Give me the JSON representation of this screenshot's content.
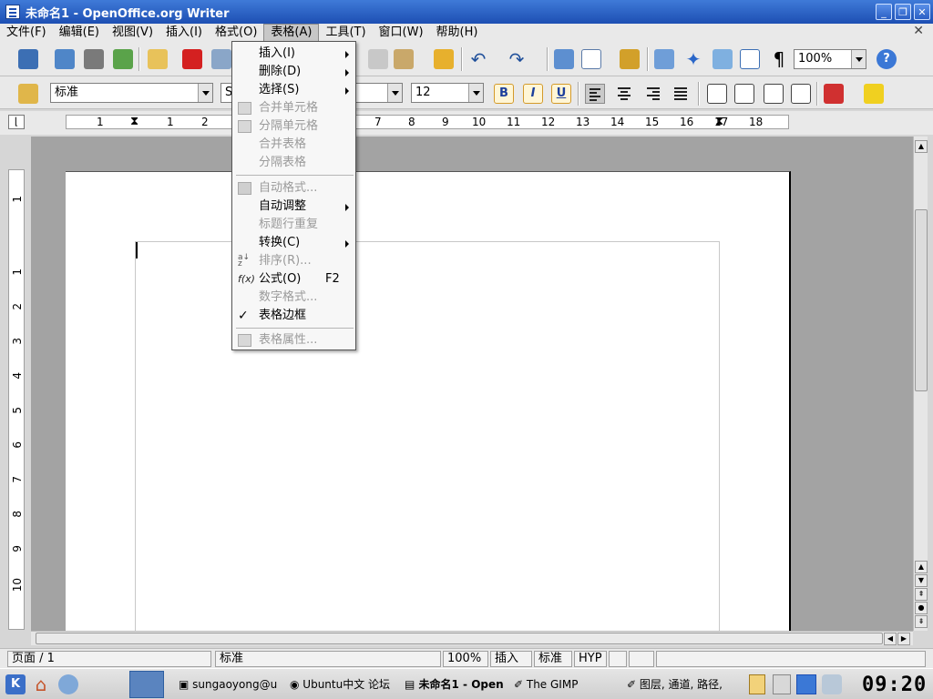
{
  "window": {
    "title": "未命名1 - OpenOffice.org Writer"
  },
  "menubar": [
    "文件(F)",
    "编辑(E)",
    "视图(V)",
    "插入(I)",
    "格式(O)",
    "表格(A)",
    "工具(T)",
    "窗口(W)",
    "帮助(H)"
  ],
  "active_menu": "表格(A)",
  "toolbar": {
    "zoom": "100%"
  },
  "formatting": {
    "style": "标准",
    "font": "S",
    "size": "12",
    "bold": "B",
    "italic": "I",
    "underline": "U"
  },
  "ruler": {
    "h_numbers": [
      "1",
      "1",
      "2",
      "7",
      "8",
      "9",
      "10",
      "11",
      "12",
      "13",
      "14",
      "15",
      "16",
      "17",
      "18"
    ],
    "v_numbers": [
      "1",
      "1",
      "2",
      "3",
      "4",
      "5",
      "6",
      "7",
      "8",
      "9",
      "10"
    ]
  },
  "table_menu": [
    {
      "label": "插入(I)",
      "enabled": true,
      "submenu": true
    },
    {
      "label": "删除(D)",
      "enabled": true,
      "submenu": true
    },
    {
      "label": "选择(S)",
      "enabled": true,
      "submenu": true
    },
    {
      "label": "合并单元格",
      "enabled": false
    },
    {
      "label": "分隔单元格",
      "enabled": false
    },
    {
      "label": "合并表格",
      "enabled": false
    },
    {
      "label": "分隔表格",
      "enabled": false
    },
    {
      "label": "自动格式...",
      "enabled": false
    },
    {
      "label": "自动调整",
      "enabled": true,
      "submenu": true
    },
    {
      "label": "标题行重复",
      "enabled": false
    },
    {
      "label": "转换(C)",
      "enabled": true,
      "submenu": true
    },
    {
      "label": "排序(R)...",
      "enabled": false
    },
    {
      "label": "公式(O)",
      "enabled": true,
      "shortcut": "F2"
    },
    {
      "label": "数字格式...",
      "enabled": false
    },
    {
      "label": "表格边框",
      "enabled": true,
      "checked": true
    },
    {
      "label": "表格属性...",
      "enabled": false
    }
  ],
  "statusbar": {
    "page": "页面 / 1",
    "style": "标准",
    "zoom": "100%",
    "mode": "插入",
    "selection": "标准",
    "hyp": "HYP"
  },
  "taskbar": {
    "tasks": [
      "sungaoyong@u",
      "Ubuntu中文 论坛",
      "未命名1 - Open",
      "The GIMP",
      "图层, 通道, 路径,"
    ],
    "clock": "09:20"
  },
  "colors": {
    "titlebar": "#2b5fc4",
    "menu_bg": "#f7f7f7",
    "doc_bg": "#a3a3a3"
  }
}
